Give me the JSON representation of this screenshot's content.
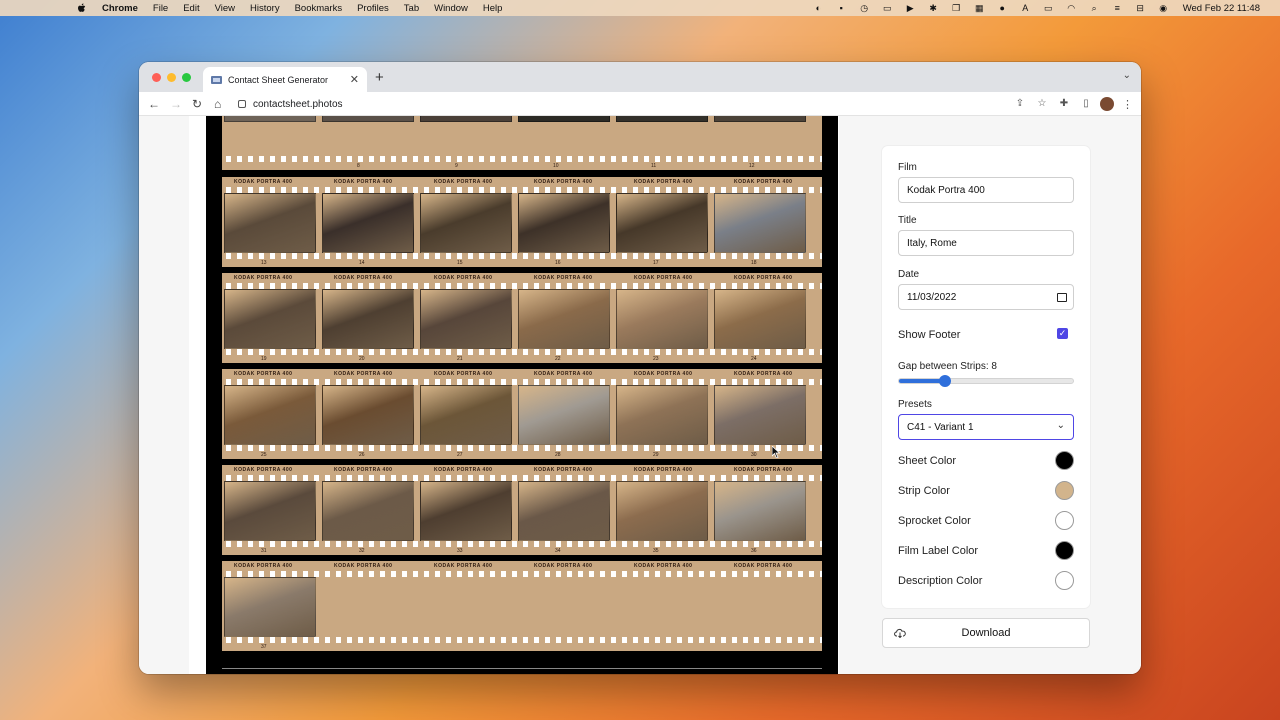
{
  "menubar": {
    "app_name": "Chrome",
    "items": [
      "File",
      "Edit",
      "View",
      "History",
      "Bookmarks",
      "Profiles",
      "Tab",
      "Window",
      "Help"
    ],
    "clock": "Wed Feb 22  11:48"
  },
  "browser": {
    "tab_title": "Contact Sheet Generator",
    "url": "contactsheet.photos"
  },
  "sheet": {
    "film_edge_label": "KODAK PORTRA 400",
    "top_frame_numbers": [
      "8",
      "9",
      "10",
      "11",
      "12"
    ],
    "strips": [
      {
        "frames": [
          "13",
          "14",
          "15",
          "16",
          "17",
          "18"
        ],
        "photos": [
          "#5a4a3a",
          "#3a2f2a",
          "#4a3c2c",
          "#3d3128",
          "#463829",
          "#7a7f88"
        ]
      },
      {
        "frames": [
          "19",
          "20",
          "21",
          "22",
          "23",
          "24"
        ],
        "photos": [
          "#5b4a3a",
          "#4e3f31",
          "#57463a",
          "#8a6a4a",
          "#9a7a5c",
          "#8c6c4a"
        ]
      },
      {
        "frames": [
          "25",
          "26",
          "27",
          "28",
          "29",
          "30"
        ],
        "photos": [
          "#7a5a3a",
          "#6a4c30",
          "#6c5638",
          "#a09a92",
          "#8e7256",
          "#7c6e66"
        ]
      },
      {
        "frames": [
          "31",
          "32",
          "33",
          "34",
          "35",
          "36"
        ],
        "photos": [
          "#5a4a3c",
          "#6c5a48",
          "#4e3e30",
          "#6a5848",
          "#8c6c4e",
          "#9a948c"
        ]
      },
      {
        "frames": [
          "37"
        ],
        "photos": [
          "#8a7a6a"
        ]
      }
    ]
  },
  "settings": {
    "film_label": "Film",
    "film_value": "Kodak Portra 400",
    "title_label": "Title",
    "title_value": "Italy, Rome",
    "date_label": "Date",
    "date_value": "11/03/2022",
    "show_footer_label": "Show Footer",
    "show_footer_checked": true,
    "gap_label": "Gap between Strips: 8",
    "gap_value": 8,
    "gap_max": 30,
    "presets_label": "Presets",
    "presets_value": "C41 - Variant 1",
    "colors": [
      {
        "label": "Sheet Color",
        "hex": "#000000"
      },
      {
        "label": "Strip Color",
        "hex": "#d2b48c"
      },
      {
        "label": "Sprocket Color",
        "hex": "#ffffff"
      },
      {
        "label": "Film Label Color",
        "hex": "#000000"
      },
      {
        "label": "Description Color",
        "hex": "#ffffff"
      }
    ],
    "download_label": "Download"
  }
}
